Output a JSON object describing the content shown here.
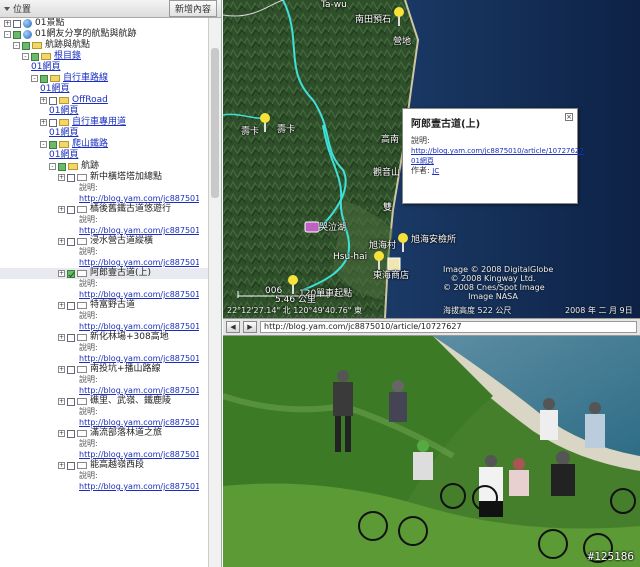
{
  "panel": {
    "title": "位置",
    "add_button": "新增內容"
  },
  "tree": [
    {
      "indent": 0,
      "exp": "+",
      "cb": "",
      "icon": "globe",
      "text": "01景點",
      "style": "lbl"
    },
    {
      "indent": 0,
      "exp": "-",
      "cb": "green",
      "icon": "globe",
      "text": "01網友分享的航點與航跡",
      "style": "lbl"
    },
    {
      "indent": 1,
      "exp": "-",
      "cb": "green",
      "icon": "folder",
      "text": "航跡與航點",
      "style": "lbl"
    },
    {
      "indent": 2,
      "exp": "-",
      "cb": "green",
      "icon": "folder",
      "text": "根目錄",
      "style": "link"
    },
    {
      "indent": 3,
      "exp": "",
      "cb": "",
      "icon": "",
      "text": "01網頁",
      "style": "link"
    },
    {
      "indent": 3,
      "exp": "-",
      "cb": "green",
      "icon": "folder",
      "text": "自行車路線",
      "style": "link"
    },
    {
      "indent": 4,
      "exp": "",
      "cb": "",
      "icon": "",
      "text": "01網頁",
      "style": "link"
    },
    {
      "indent": 4,
      "exp": "+",
      "cb": "",
      "icon": "folder",
      "text": "OffRoad",
      "style": "link"
    },
    {
      "indent": 5,
      "exp": "",
      "cb": "",
      "icon": "",
      "text": "01網頁",
      "style": "link"
    },
    {
      "indent": 4,
      "exp": "+",
      "cb": "",
      "icon": "folder",
      "text": "自行車專用道",
      "style": "link"
    },
    {
      "indent": 5,
      "exp": "",
      "cb": "",
      "icon": "",
      "text": "01網頁",
      "style": "link"
    },
    {
      "indent": 4,
      "exp": "-",
      "cb": "green",
      "icon": "folder",
      "text": "爬山鐵路",
      "style": "link"
    },
    {
      "indent": 5,
      "exp": "",
      "cb": "",
      "icon": "",
      "text": "01網頁",
      "style": "link"
    },
    {
      "indent": 5,
      "exp": "-",
      "cb": "green",
      "icon": "folder",
      "text": "航跡",
      "style": "lbl"
    }
  ],
  "tracks": [
    {
      "name": "新中橫塔塔加總點",
      "checked": false,
      "selected": false
    },
    {
      "name": "橘後舊鐵古道悠遊行",
      "checked": false,
      "selected": false
    },
    {
      "name": "浸水營古道縱橫",
      "checked": false,
      "selected": false
    },
    {
      "name": "阿郎壹古道(上)",
      "checked": true,
      "selected": true
    },
    {
      "name": "特富野古道",
      "checked": false,
      "selected": false
    },
    {
      "name": "新化林場+308高地",
      "checked": false,
      "selected": false
    },
    {
      "name": "南投坑+播山路線",
      "checked": false,
      "selected": false
    },
    {
      "name": "礁里、武嶺、鐵鹿陵",
      "checked": false,
      "selected": false
    },
    {
      "name": "滿流部落林道之旅",
      "checked": false,
      "selected": false
    },
    {
      "name": "能高越嶺西段",
      "checked": false,
      "selected": false
    }
  ],
  "track_desc_label": "說明:",
  "track_url": "http://blog.yam.com/jc8875010/ar",
  "map": {
    "labels": {
      "nantian": "南田預石",
      "yingdi": "營地",
      "shouka1": "壽卡",
      "shouka2": "壽卡",
      "gaonan": "高南",
      "guanyin": "觀音山",
      "shuang": "雙",
      "kuqi": "哭泣湖",
      "xuhai_village": "旭海村",
      "xuhai_station": "旭海安檢所",
      "donghai": "東海商店",
      "xuhai_en": "Hsu-hai",
      "start": "120單車起點",
      "num": "006",
      "taya": "Ta-wu"
    },
    "copyright": [
      "Image © 2008 DigitalGlobe",
      "© 2008 Kingway Ltd.",
      "© 2008 Cnes/Spot Image",
      "Image NASA"
    ],
    "coords": "22°12'27.14\" 北   120°49'40.76\" 東",
    "elevation": "海拔高度  522 公尺",
    "date": "2008 年 二 月 9日",
    "scale": "5.46 公里"
  },
  "popup": {
    "title": "阿郎壹古道(上)",
    "desc_label": "說明:",
    "link": "http://blog.yam.com/jc8875010/article/10727627",
    "page_link": "01網頁",
    "author_label": "作者:",
    "author": "JC"
  },
  "browser": {
    "back": "◀",
    "forward": "▶",
    "url": "http://blog.yam.com/jc8875010/article/10727627"
  },
  "photo": {
    "watermark": "#125186"
  },
  "colors": {
    "track": "#3ee0d8",
    "pin": "#f7e23a",
    "sea": "#16305a",
    "land": "#2e4f2a"
  }
}
